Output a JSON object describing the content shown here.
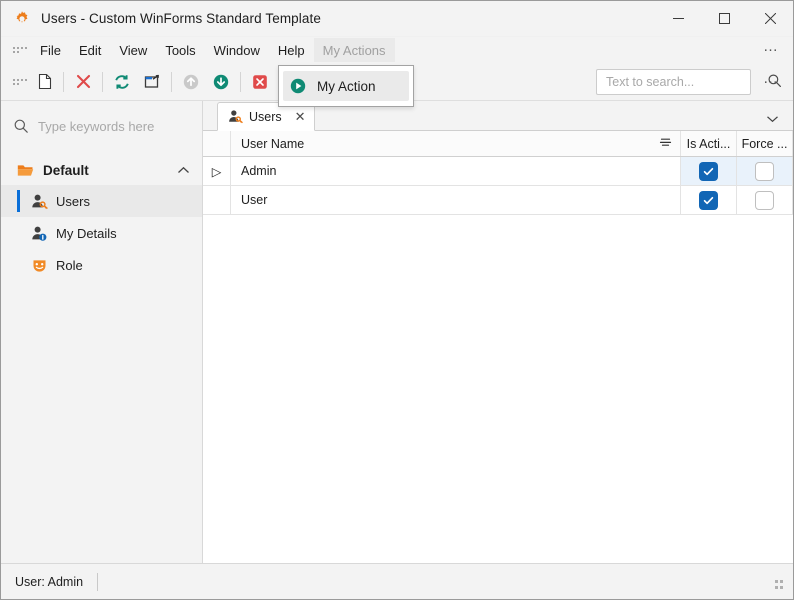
{
  "window": {
    "title": "Users - Custom WinForms Standard Template",
    "app_icon": "gear-icon",
    "minimize_label": "–",
    "maximize_label": "❐",
    "close_label": "✕"
  },
  "menubar": {
    "items": [
      {
        "label": "File"
      },
      {
        "label": "Edit"
      },
      {
        "label": "View"
      },
      {
        "label": "Tools"
      },
      {
        "label": "Window"
      },
      {
        "label": "Help"
      },
      {
        "label": "My Actions"
      }
    ],
    "overflow_label": "…"
  },
  "dropdown": {
    "visible": true,
    "items": [
      {
        "label": "My Action",
        "icon": "play-circle-icon"
      }
    ]
  },
  "toolbar": {
    "buttons": [
      {
        "name": "new-icon",
        "title": "New"
      },
      {
        "name": "delete-icon",
        "title": "Delete"
      },
      {
        "name": "refresh-icon",
        "title": "Refresh"
      },
      {
        "name": "export-icon",
        "title": "Export"
      },
      {
        "name": "move-up-icon",
        "title": "Move Up"
      },
      {
        "name": "move-down-icon",
        "title": "Move Down"
      },
      {
        "name": "cancel-icon",
        "title": "Cancel"
      }
    ],
    "overflow_label": "…"
  },
  "search": {
    "placeholder": "Text to search...",
    "value": "",
    "icon": "search-icon"
  },
  "sidebar": {
    "search": {
      "placeholder": "Type keywords here",
      "value": "",
      "icon": "search-icon"
    },
    "group": {
      "label": "Default",
      "icon": "folder-open-icon",
      "collapse_icon": "chevron-up-icon",
      "expanded": true
    },
    "items": [
      {
        "label": "Users",
        "icon": "user-key-icon",
        "selected": true
      },
      {
        "label": "My Details",
        "icon": "user-info-icon",
        "selected": false
      },
      {
        "label": "Role",
        "icon": "mask-icon",
        "selected": false
      }
    ]
  },
  "tabs": {
    "items": [
      {
        "label": "Users",
        "icon": "user-key-icon",
        "close_label": "✕",
        "active": true
      }
    ],
    "overflow_icon": "chevron-down-icon"
  },
  "grid": {
    "columns": [
      {
        "label": "User Name",
        "sort_icon": "filter-icon"
      },
      {
        "label": "Is Acti..."
      },
      {
        "label": "Force ..."
      }
    ],
    "rows": [
      {
        "indicator": "▷",
        "user_name": "Admin",
        "is_active": true,
        "force": false,
        "selected": true
      },
      {
        "indicator": "",
        "user_name": "User",
        "is_active": true,
        "force": false,
        "selected": false
      }
    ]
  },
  "statusbar": {
    "user_text": "User: Admin"
  },
  "colors": {
    "accent_orange": "#ED7D1B",
    "accent_blue": "#1266b5",
    "accent_teal": "#0f8a74",
    "accent_red": "#E04A4A",
    "selection_bar": "#0a6fd8",
    "chrome_bg": "#f3f3f3"
  }
}
